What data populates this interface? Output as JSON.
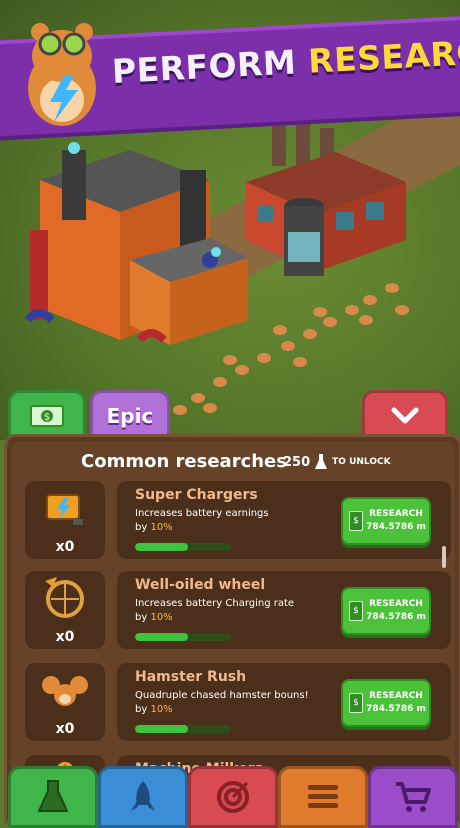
{
  "banner": {
    "word1": "PERFORM",
    "word2": "RESEARCHES"
  },
  "tabs": {
    "money_icon": "cash-icon",
    "epic_label": "Epic",
    "collapse_icon": "chevron-down-icon"
  },
  "panel": {
    "title": "Common researches",
    "unlock_count": "250",
    "unlock_text": "TO UNLOCK",
    "unlock_icon": "flask-icon"
  },
  "researches": [
    {
      "name": "Super Chargers",
      "desc_line1": "Increases battery earnings",
      "desc_by": "by",
      "pct": "10%",
      "count": "x0",
      "progress": 0.55,
      "button_label": "RESEARCH",
      "cost": "784.5786 m",
      "icon": "battery-charger-icon"
    },
    {
      "name": "Well-oiled wheel",
      "desc_line1": "Increases battery Charging rate",
      "desc_by": "by",
      "pct": "10%",
      "count": "x0",
      "progress": 0.55,
      "button_label": "RESEARCH",
      "cost": "784.5786 m",
      "icon": "hamster-wheel-icon"
    },
    {
      "name": "Hamster Rush",
      "desc_line1": "Quadruple chased hamster bouns!",
      "desc_by": "by",
      "pct": "10%",
      "count": "x0",
      "progress": 0.55,
      "button_label": "RESEARCH",
      "cost": "784.5786 m",
      "icon": "hamsters-icon"
    },
    {
      "name": "Machine Milkers",
      "icon": "machine-icon"
    }
  ],
  "bottom_nav": [
    {
      "icon": "flask-icon",
      "color": "#3fb54a"
    },
    {
      "icon": "rocket-icon",
      "color": "#3a8ed6"
    },
    {
      "icon": "target-icon",
      "color": "#d94b53"
    },
    {
      "icon": "menu-icon",
      "color": "#e07a2c"
    },
    {
      "icon": "cart-icon",
      "color": "#9b4cc8"
    }
  ],
  "colors": {
    "banner": "#7b2fa8",
    "accent": "#ffd93b",
    "button": "#4cc23a",
    "panel": "#5a3a22"
  }
}
